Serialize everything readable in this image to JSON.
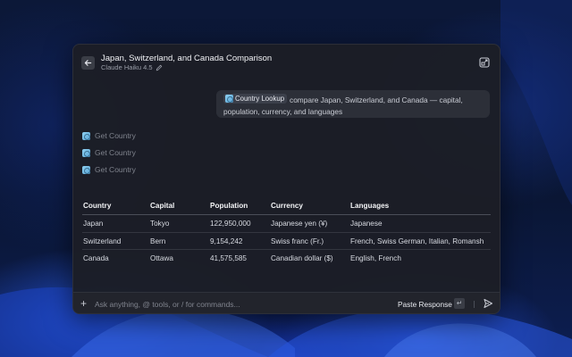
{
  "window": {
    "title": "Japan, Switzerland, and Canada Comparison",
    "model": "Claude Haiku 4.5"
  },
  "user_message": {
    "tool_chip": "Country Lookup",
    "text": "compare Japan, Switzerland, and Canada — capital, population, currency, and languages"
  },
  "tool_calls": [
    {
      "label": "Get Country"
    },
    {
      "label": "Get Country"
    },
    {
      "label": "Get Country"
    }
  ],
  "table": {
    "headers": [
      "Country",
      "Capital",
      "Population",
      "Currency",
      "Languages"
    ],
    "rows": [
      [
        "Japan",
        "Tokyo",
        "122,950,000",
        "Japanese yen (¥)",
        "Japanese"
      ],
      [
        "Switzerland",
        "Bern",
        "9,154,242",
        "Swiss franc (Fr.)",
        "French, Swiss German, Italian, Romansh"
      ],
      [
        "Canada",
        "Ottawa",
        "41,575,585",
        "Canadian dollar ($)",
        "English, French"
      ]
    ]
  },
  "composer": {
    "placeholder": "Ask anything, @ tools, or / for commands...",
    "paste_label": "Paste Response",
    "enter_key": "↵"
  },
  "icons": {
    "back": "arrow-left-icon",
    "model_edit": "pencil-icon",
    "expand": "expand-icon",
    "tool": "tool-globe-icon",
    "add": "plus-icon",
    "send": "send-icon"
  }
}
